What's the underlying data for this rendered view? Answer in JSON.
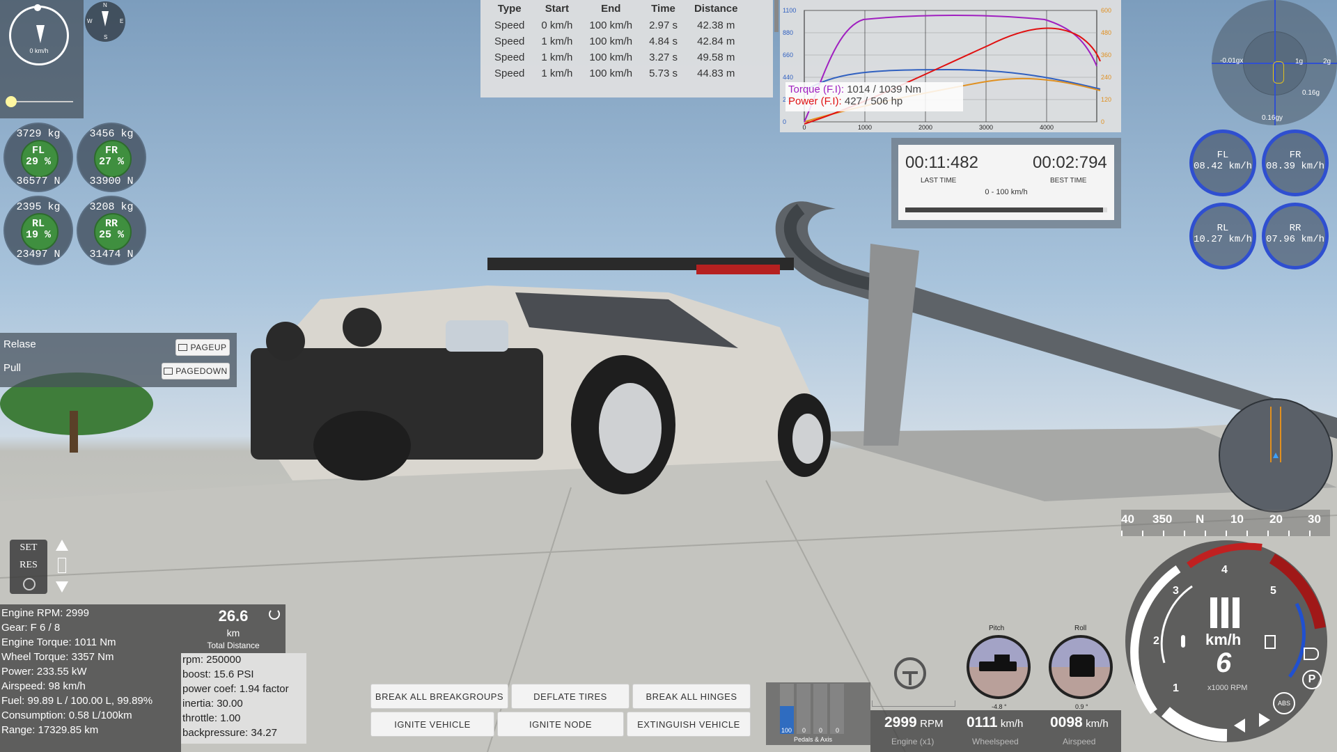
{
  "compass": {
    "speed": "0 km/h",
    "n": "N",
    "s": "S",
    "e": "E",
    "w": "W"
  },
  "wheels_load": [
    {
      "weight": "3729 kg",
      "id": "FL",
      "pct": "29 %",
      "force": "36577 N"
    },
    {
      "weight": "3456 kg",
      "id": "FR",
      "pct": "27 %",
      "force": "33900 N"
    },
    {
      "weight": "2395 kg",
      "id": "RL",
      "pct": "19 %",
      "force": "23497 N"
    },
    {
      "weight": "3208 kg",
      "id": "RR",
      "pct": "25 %",
      "force": "31474 N"
    }
  ],
  "winch": {
    "release_label": "Relase",
    "release_key": "PAGEUP",
    "pull_label": "Pull",
    "pull_key": "PAGEDOWN"
  },
  "timing_table": {
    "headers": [
      "Type",
      "Start",
      "End",
      "Time",
      "Distance"
    ],
    "rows": [
      [
        "Speed",
        "0 km/h",
        "100 km/h",
        "2.97 s",
        "42.38 m"
      ],
      [
        "Speed",
        "1 km/h",
        "100 km/h",
        "4.84 s",
        "42.84 m"
      ],
      [
        "Speed",
        "1 km/h",
        "100 km/h",
        "3.27 s",
        "49.58 m"
      ],
      [
        "Speed",
        "1 km/h",
        "100 km/h",
        "5.73 s",
        "44.83 m"
      ]
    ]
  },
  "torque_chart": {
    "left_ticks": [
      "1100",
      "880",
      "660",
      "440",
      "220",
      "0"
    ],
    "right_ticks": [
      "600",
      "480",
      "360",
      "240",
      "120",
      "0"
    ],
    "x_ticks": [
      "0",
      "1000",
      "2000",
      "3000",
      "4000"
    ],
    "torque_label": "Torque (F.I):",
    "torque_value": "1014 / 1039 Nm",
    "power_label": "Power (F.I):",
    "power_value": "427 / 506 hp",
    "colors": {
      "torque": "#a020c0",
      "power": "#e01010",
      "torque_base": "#3060c0",
      "power_base": "#e09020"
    }
  },
  "timer": {
    "last_time": "00:11:482",
    "last_label": "LAST TIME",
    "best_time": "00:02:794",
    "best_label": "BEST TIME",
    "mode": "0 - 100 km/h",
    "progress": 0.98
  },
  "gforce": {
    "x_label": "-0.01gx",
    "right_label": "2g",
    "mid_label": "1g",
    "y1_label": "0.16g",
    "y2_label": "0.16gy"
  },
  "wheel_speeds": [
    {
      "id": "FL",
      "speed": "08.42 km/h"
    },
    {
      "id": "FR",
      "speed": "08.39 km/h"
    },
    {
      "id": "RL",
      "speed": "10.27 km/h"
    },
    {
      "id": "RR",
      "speed": "07.96 km/h"
    }
  ],
  "heading": {
    "ticks": [
      "40",
      "350",
      "N",
      "10",
      "20",
      "30"
    ]
  },
  "cruise": {
    "set": "SET",
    "res": "RES"
  },
  "engine_info": {
    "lines": [
      "Engine RPM: 2999",
      "Gear: F 6 / 8",
      "Engine Torque: 1011 Nm",
      "Wheel Torque: 3357 Nm",
      "Power: 233.55 kW",
      "Airspeed: 98 km/h",
      "Fuel: 99.89 L / 100.00 L, 99.89%",
      "Consumption: 0.58 L/100km",
      "Range: 17329.85 km"
    ]
  },
  "odometer": {
    "value": "26.6",
    "unit": "km",
    "label": "Total Distance"
  },
  "turbo": {
    "lines": [
      "rpm: 250000",
      "boost: 15.6 PSI",
      "power coef: 1.94 factor",
      "inertia: 30.00",
      "throttle: 1.00",
      "backpressure: 34.27"
    ]
  },
  "actions": {
    "break_groups": "BREAK ALL BREAKGROUPS",
    "deflate": "DEFLATE TIRES",
    "break_hinges": "BREAK ALL HINGES",
    "ignite_vehicle": "IGNITE VEHICLE",
    "ignite_node": "IGNITE NODE",
    "extinguish": "EXTINGUISH VEHICLE"
  },
  "pedals": {
    "values": [
      "100",
      "0",
      "0",
      "0"
    ],
    "label": "Pedals & Axis",
    "throttle_fill": 0.55
  },
  "speed_readout": {
    "rpm": "2999",
    "rpm_unit": "RPM",
    "rpm_label": "Engine (x1)",
    "wheel": "0111",
    "wheel_unit": "km/h",
    "wheel_label": "Wheelspeed",
    "air": "0098",
    "air_unit": "km/h",
    "air_label": "Airspeed"
  },
  "attitude": {
    "pitch_label": "Pitch",
    "pitch_value": "-4.8 °",
    "roll_label": "Roll",
    "roll_value": "0.9 °"
  },
  "tacho": {
    "gear": "6",
    "unit": "km/h",
    "rpm_label": "x1000 RPM",
    "ticks": [
      "1",
      "2",
      "3",
      "4",
      "5"
    ],
    "abs": "ABS",
    "park": "P"
  }
}
